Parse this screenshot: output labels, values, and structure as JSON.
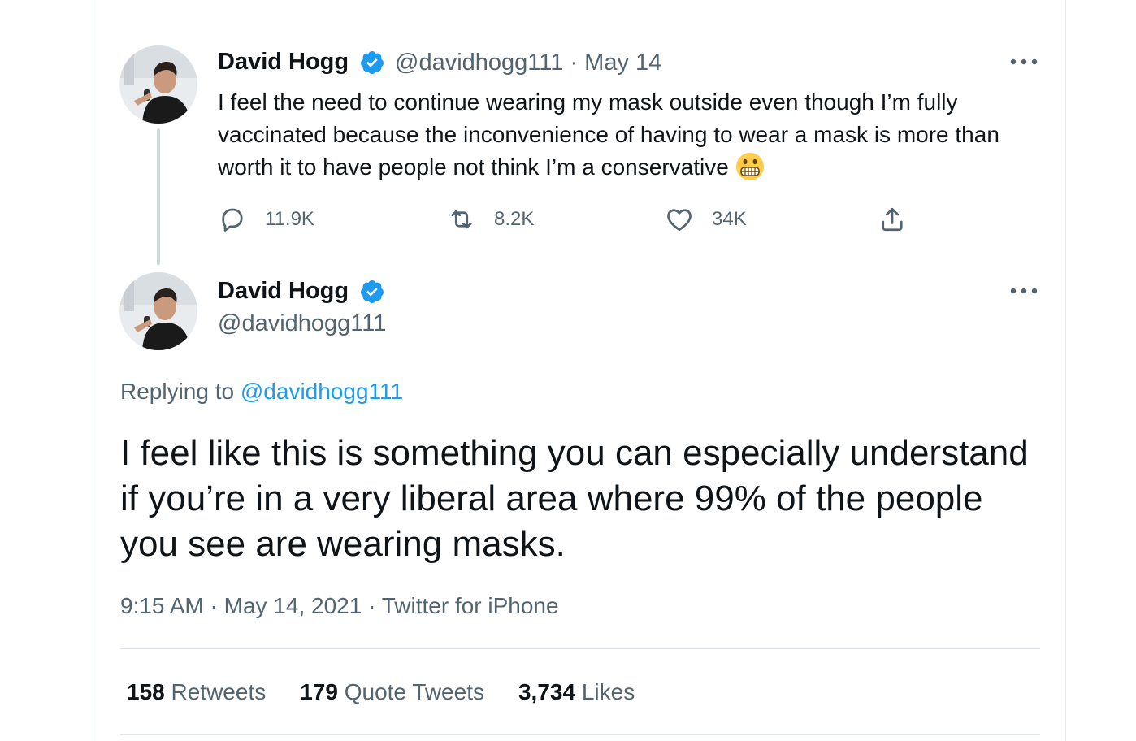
{
  "tweet1": {
    "author_name": "David Hogg",
    "handle": "@davidhogg111",
    "separator": "·",
    "date": "May 14",
    "text": "I feel the need to continue wearing my mask outside even though I’m fully vaccinated because the inconvenience of having to wear a mask is more than worth it to have people not think I’m a conservative",
    "emoji_icon": "grimacing-face-icon",
    "actions": {
      "replies": "11.9K",
      "retweets": "8.2K",
      "likes": "34K"
    }
  },
  "tweet2": {
    "author_name": "David Hogg",
    "handle": "@davidhogg111",
    "replying_prefix": "Replying to",
    "replying_to": "@davidhogg111",
    "text": "I feel like this is something you can especially understand if you’re in a very liberal area where 99% of the people you see are wearing masks.",
    "time": "9:15 AM",
    "date": "May 14, 2021",
    "source": "Twitter for iPhone",
    "stats": {
      "retweets_count": "158",
      "retweets_label": "Retweets",
      "quotes_count": "179",
      "quotes_label": "Quote Tweets",
      "likes_count": "3,734",
      "likes_label": "Likes"
    }
  },
  "colors": {
    "accent": "#1d9bf0",
    "text_primary": "#0f1419",
    "text_secondary": "#536471",
    "thread_line": "#cfd9de"
  }
}
